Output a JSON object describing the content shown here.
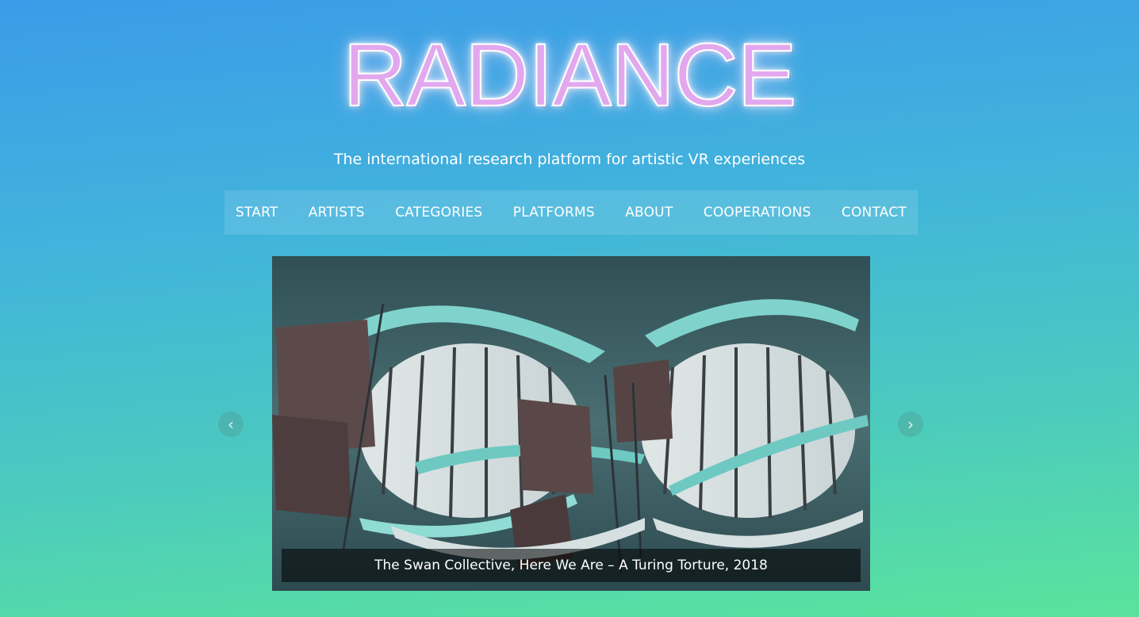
{
  "site": {
    "logo_text": "RADIANCE",
    "tagline": "The international research platform for artistic VR experiences"
  },
  "nav": {
    "items": [
      {
        "label": "START"
      },
      {
        "label": "ARTISTS"
      },
      {
        "label": "CATEGORIES"
      },
      {
        "label": "PLATFORMS"
      },
      {
        "label": "ABOUT"
      },
      {
        "label": "COOPERATIONS"
      },
      {
        "label": "CONTACT"
      }
    ]
  },
  "slider": {
    "caption": "The Swan Collective, Here We Are – A Turing Torture, 2018",
    "prev_icon": "‹",
    "next_icon": "›"
  },
  "colors": {
    "gradient_top": "#3a9ce8",
    "gradient_bottom": "#5ae39c",
    "logo_fill": "#e2a8ee"
  }
}
